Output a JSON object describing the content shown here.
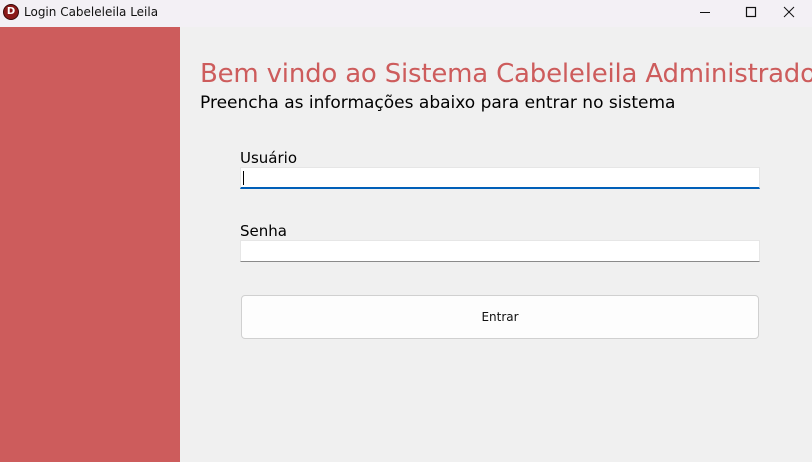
{
  "window": {
    "title": "Login Cabeleleila Leila",
    "icon_letter": "D"
  },
  "login": {
    "heading": "Bem vindo ao Sistema Cabeleleila Administrador",
    "subheading": "Preencha as informações abaixo para entrar no sistema",
    "username_label": "Usuário",
    "username_value": "",
    "password_label": "Senha",
    "password_value": "",
    "submit_label": "Entrar"
  },
  "colors": {
    "accent": "#cd5c5c",
    "focus": "#005fb8",
    "background": "#f0f0f0"
  },
  "icons": {
    "app": "app-logo-icon",
    "minimize": "minimize-icon",
    "maximize": "maximize-icon",
    "close": "close-icon"
  }
}
